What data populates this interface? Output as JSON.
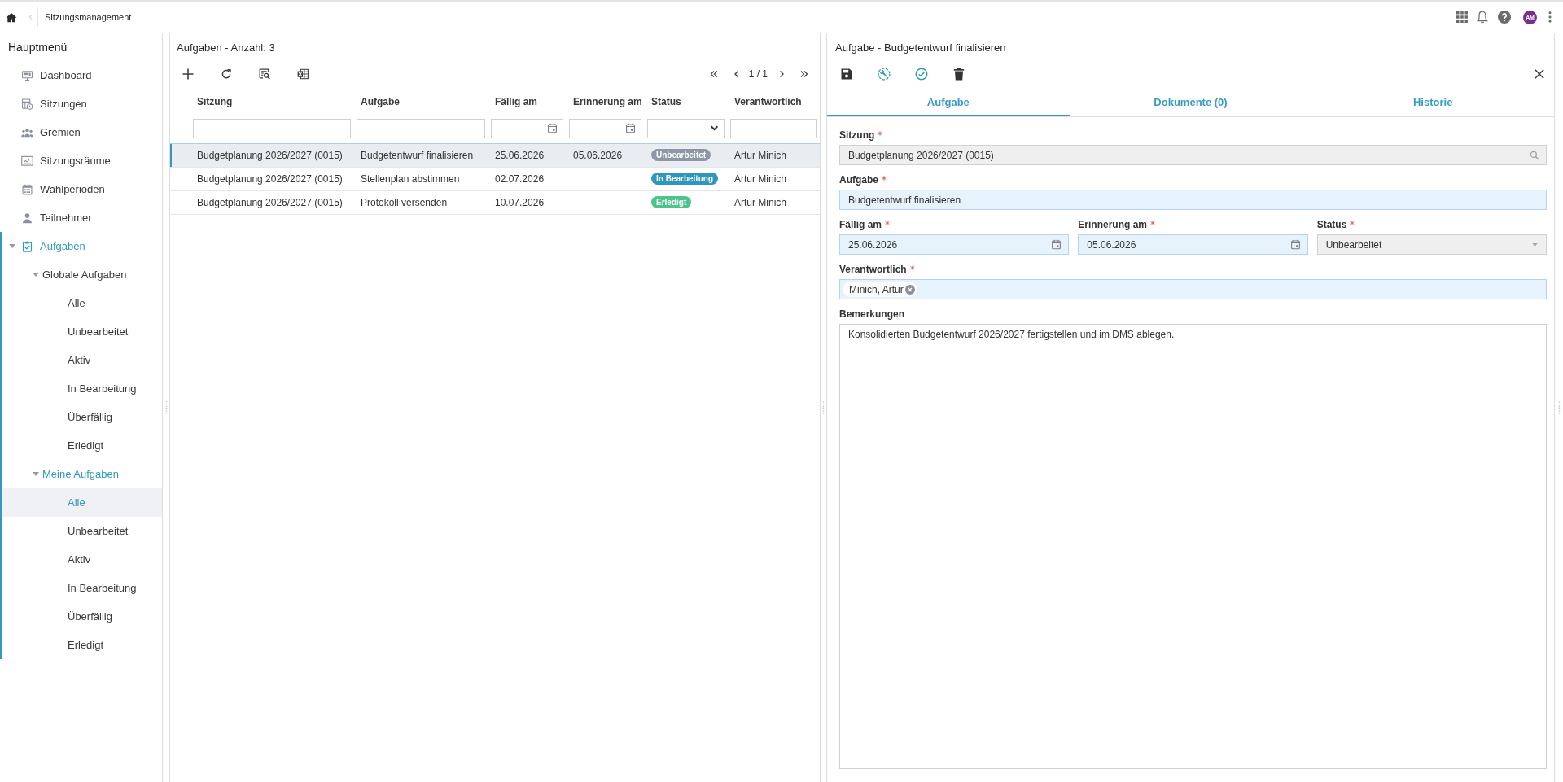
{
  "top_bar": {
    "breadcrumb": "Sitzungsmanagement",
    "avatar": "AM"
  },
  "sidebar": {
    "title": "Hauptmenü",
    "items": [
      {
        "label": "Dashboard",
        "selected": false
      },
      {
        "label": "Sitzungen",
        "selected": false
      },
      {
        "label": "Gremien",
        "selected": false
      },
      {
        "label": "Sitzungsräume",
        "selected": false
      },
      {
        "label": "Wahlperioden",
        "selected": false
      },
      {
        "label": "Teilnehmer",
        "selected": false
      },
      {
        "label": "Aufgaben",
        "selected": false,
        "expanded": true,
        "children": [
          {
            "label": "Globale Aufgaben",
            "selected": false,
            "expanded": true,
            "children": [
              {
                "label": "Alle",
                "selected": false
              },
              {
                "label": "Unbearbeitet",
                "selected": false
              },
              {
                "label": "Aktiv",
                "selected": false
              },
              {
                "label": "In Bearbeitung",
                "selected": false
              },
              {
                "label": "Überfällig",
                "selected": false
              },
              {
                "label": "Erledigt",
                "selected": false
              }
            ]
          },
          {
            "label": "Meine Aufgaben",
            "selected": false,
            "expanded": true,
            "children": [
              {
                "label": "Alle",
                "selected": true
              },
              {
                "label": "Unbearbeitet",
                "selected": false
              },
              {
                "label": "Aktiv",
                "selected": false
              },
              {
                "label": "In Bearbeitung",
                "selected": false
              },
              {
                "label": "Überfällig",
                "selected": false
              },
              {
                "label": "Erledigt",
                "selected": false
              }
            ]
          }
        ]
      }
    ]
  },
  "list": {
    "title": "Aufgaben - Anzahl: 3",
    "pager": "1 / 1",
    "columns": [
      {
        "label": "Sitzung",
        "kind": "text"
      },
      {
        "label": "Aufgabe",
        "kind": "text"
      },
      {
        "label": "Fällig am",
        "kind": "date"
      },
      {
        "label": "Erinnerung am",
        "kind": "date"
      },
      {
        "label": "Status",
        "kind": "select"
      },
      {
        "label": "Verantwortlich",
        "kind": "text"
      }
    ],
    "rows": [
      {
        "selected": true,
        "sitzung": "Budgetplanung 2026/2027 (0015)",
        "aufgabe": "Budgetentwurf finalisieren",
        "faellig_am": "25.06.2026",
        "erinnerung_am": "05.06.2026",
        "status": {
          "label": "Unbearbeitet",
          "color": "#8e97a6"
        },
        "verantwortlich": "Artur Minich"
      },
      {
        "selected": false,
        "sitzung": "Budgetplanung 2026/2027 (0015)",
        "aufgabe": "Stellenplan abstimmen",
        "faellig_am": "02.07.2026",
        "status": {
          "label": "In Bearbeitung",
          "color": "#2e97bd"
        },
        "verantwortlich": "Artur Minich"
      },
      {
        "selected": false,
        "sitzung": "Budgetplanung 2026/2027 (0015)",
        "aufgabe": "Protokoll versenden",
        "faellig_am": "10.07.2026",
        "status": {
          "label": "Erledigt",
          "color": "#4dc48c"
        },
        "verantwortlich": "Artur Minich"
      }
    ]
  },
  "detail": {
    "title": "Aufgabe - Budgetentwurf finalisieren",
    "tabs": [
      {
        "label": "Aufgabe",
        "selected": true
      },
      {
        "label": "Dokumente (0)",
        "selected": false
      },
      {
        "label": "Historie",
        "selected": false
      }
    ],
    "form_rows": [
      [
        {
          "label": "Sitzung",
          "required": true,
          "disabled": true,
          "kind": "lookup",
          "value": "Budgetplanung 2026/2027 (0015)"
        }
      ],
      [
        {
          "label": "Aufgabe",
          "required": true,
          "disabled": false,
          "kind": "text",
          "value": "Budgetentwurf finalisieren"
        }
      ],
      [
        {
          "label": "Fällig am",
          "required": true,
          "disabled": false,
          "kind": "date",
          "value": "25.06.2026"
        },
        {
          "label": "Erinnerung am",
          "required": true,
          "disabled": false,
          "kind": "date",
          "value": "05.06.2026"
        },
        {
          "label": "Status",
          "required": true,
          "disabled": true,
          "kind": "select",
          "value": "Unbearbeitet"
        }
      ],
      [
        {
          "label": "Verantwortlich",
          "required": true,
          "disabled": false,
          "kind": "tags",
          "tags": [
            "Minich, Artur"
          ]
        }
      ],
      [
        {
          "label": "Bemerkungen",
          "required": false,
          "disabled": false,
          "kind": "textarea",
          "value": "Konsolidierten Budgetentwurf 2026/2027 fertigstellen und im DMS ablegen."
        }
      ]
    ]
  }
}
